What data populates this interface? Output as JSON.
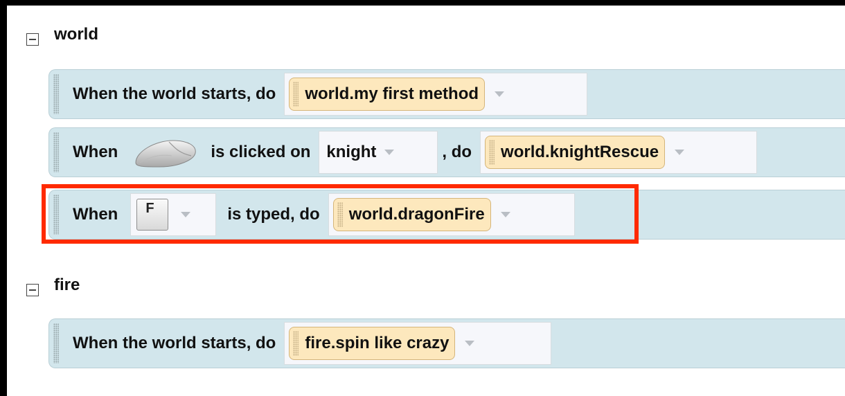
{
  "groups": [
    {
      "title": "world"
    },
    {
      "title": "fire"
    }
  ],
  "events": {
    "world_start": {
      "label": "When the world starts,  do",
      "method": "world.my first method"
    },
    "mouse_click": {
      "when": "When",
      "icon": "mouse-icon",
      "clicked": "is clicked on",
      "object": "knight",
      "do": ",  do",
      "method": "world.knightRescue"
    },
    "key_typed": {
      "when": "When",
      "key": "F",
      "typed": "is typed,  do",
      "method": "world.dragonFire"
    },
    "fire_start": {
      "label": "When the world starts,  do",
      "method": "fire.spin like crazy"
    }
  },
  "colors": {
    "event_block": "#d2e6ec",
    "method_pill": "#fde8bd",
    "highlight": "#ff2a00"
  }
}
